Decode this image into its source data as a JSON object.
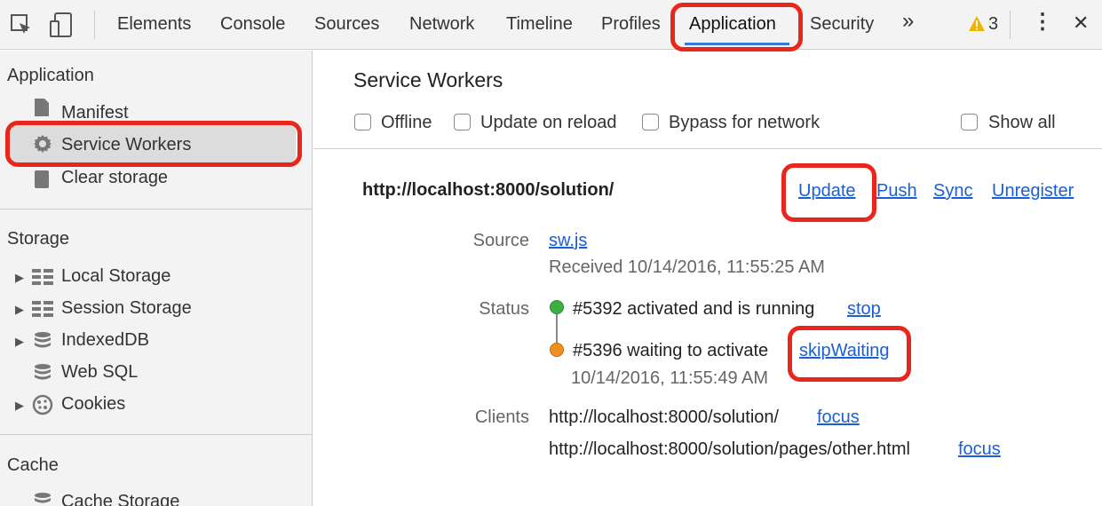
{
  "toolbar": {
    "tabs": [
      {
        "label": "Elements"
      },
      {
        "label": "Console"
      },
      {
        "label": "Sources"
      },
      {
        "label": "Network"
      },
      {
        "label": "Timeline"
      },
      {
        "label": "Profiles"
      },
      {
        "label": "Application"
      },
      {
        "label": "Security"
      }
    ],
    "overflow_label": "»",
    "warning_count": "3",
    "menu_label": "⋮",
    "close_label": "✕"
  },
  "sidebar": {
    "application_heading": "Application",
    "application_items": [
      {
        "label": "Manifest",
        "icon": "file-icon"
      },
      {
        "label": "Service Workers",
        "icon": "gear-icon"
      },
      {
        "label": "Clear storage",
        "icon": "database-icon"
      }
    ],
    "storage_heading": "Storage",
    "storage_items": [
      {
        "label": "Local Storage",
        "icon": "grid-icon"
      },
      {
        "label": "Session Storage",
        "icon": "grid-icon"
      },
      {
        "label": "IndexedDB",
        "icon": "database-icon"
      },
      {
        "label": "Web SQL",
        "icon": "database-icon"
      },
      {
        "label": "Cookies",
        "icon": "cookie-icon"
      }
    ],
    "cache_heading": "Cache",
    "cache_items": [
      {
        "label": "Cache Storage",
        "icon": "database-icon"
      }
    ]
  },
  "main": {
    "title": "Service Workers",
    "options": {
      "offline": "Offline",
      "update_on_reload": "Update on reload",
      "bypass_for_network": "Bypass for network",
      "show_all": "Show all"
    },
    "worker": {
      "scope": "http://localhost:8000/solution/",
      "actions": {
        "update": "Update",
        "push": "Push",
        "sync": "Sync",
        "unregister": "Unregister"
      },
      "source_label": "Source",
      "source_file": "sw.js",
      "received": "Received 10/14/2016, 11:55:25 AM",
      "status_label": "Status",
      "status_running": "#5392 activated and is running",
      "stop_label": "stop",
      "status_waiting": "#5396 waiting to activate",
      "skip_waiting_label": "skipWaiting",
      "waiting_time": "10/14/2016, 11:55:49 AM",
      "clients_label": "Clients",
      "clients": [
        {
          "url": "http://localhost:8000/solution/",
          "action": "focus"
        },
        {
          "url": "http://localhost:8000/solution/pages/other.html",
          "action": "focus"
        }
      ]
    }
  },
  "colors": {
    "annotation": "#e8261c",
    "link": "#1a5fd6",
    "running_dot": "#3cb043",
    "waiting_dot": "#f0901e",
    "warning": "#f0b400"
  }
}
